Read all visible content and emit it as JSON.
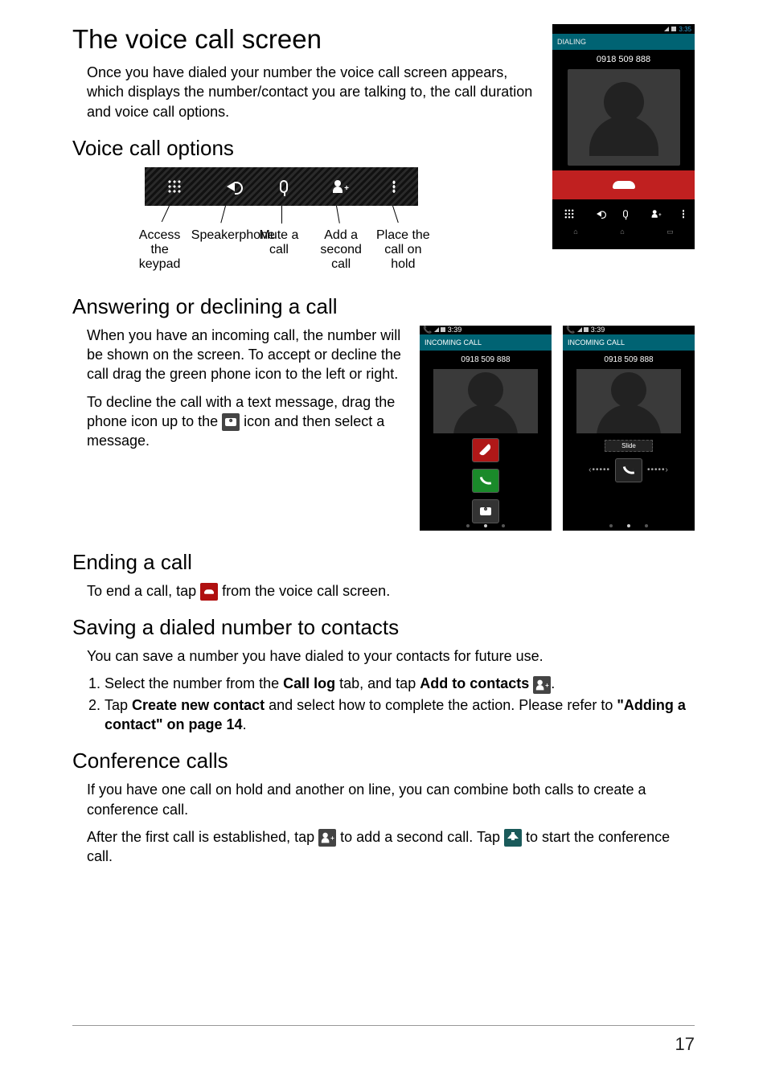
{
  "sections": {
    "voice_call": {
      "title": "The voice call screen",
      "intro": "Once you have dialed your number the voice call screen appears, which displays the number/contact you are talking to, the call duration and voice call options."
    },
    "options": {
      "title": "Voice call options",
      "labels": {
        "keypad": "Access the keypad",
        "speaker": "Speakerphone",
        "mute": "Mute a call",
        "add": "Add a second call",
        "hold": "Place the call on hold"
      }
    },
    "answering": {
      "title": "Answering or declining a call",
      "p1": "When you have an incoming call, the number will be shown on the screen. To accept or decline the call drag the green phone icon to the left or right.",
      "p2a": "To decline the call with a text message, drag the phone icon up to the ",
      "p2b": " icon and then select a message."
    },
    "ending": {
      "title": "Ending a call",
      "p1a": "To end a call, tap ",
      "p1b": " from the voice call screen."
    },
    "saving": {
      "title": "Saving a dialed number to contacts",
      "p1": "You can save a number you have dialed to your contacts for future use.",
      "li1a": "Select the number from the ",
      "li1b": "Call log",
      "li1c": " tab, and tap ",
      "li1d": "Add to contacts",
      "li1e": " ",
      "li1f": ".",
      "li2a": "Tap ",
      "li2b": "Create new contact",
      "li2c": " and select how to complete the action. Please refer to ",
      "li2d": "\"Adding a contact\" on page 14",
      "li2e": "."
    },
    "conference": {
      "title": "Conference calls",
      "p1": "If you have one call on hold and another on line, you can combine both calls to create a conference call.",
      "p2a": "After the first call is established, tap ",
      "p2b": " to add a second call. Tap ",
      "p2c": " to start the conference call."
    }
  },
  "phone_dialing": {
    "status_time": "3:35",
    "header": "DIALING",
    "number": "0918 509 888"
  },
  "phone_incoming": {
    "status_time": "3:39",
    "header": "INCOMING CALL",
    "number": "0918 509 888",
    "slide_label": "Slide"
  },
  "page_number": "17"
}
